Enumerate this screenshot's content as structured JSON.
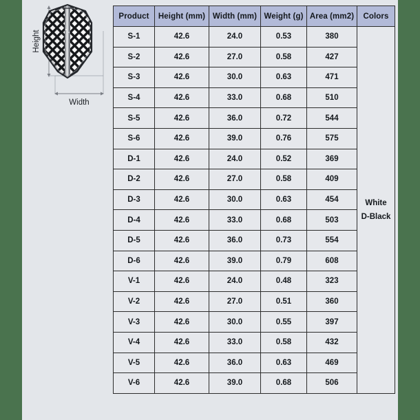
{
  "page": {
    "background_color": "#e3e6ea",
    "border_color": "#4a734e"
  },
  "diagram": {
    "name": "dart-flight-dimension-diagram",
    "height_label": "Height",
    "width_label": "Width",
    "shape": "standard-dart-flight",
    "pattern": "diamond-crosshatch-mesh"
  },
  "table": {
    "headers": [
      "Product",
      "Height (mm)",
      "Width (mm)",
      "Weight (g)",
      "Area (mm2)",
      "Colors"
    ],
    "colors_cell": [
      "White",
      "D-Black"
    ],
    "rows": [
      {
        "product": "S-1",
        "height": "42.6",
        "width": "24.0",
        "weight": "0.53",
        "area": "380"
      },
      {
        "product": "S-2",
        "height": "42.6",
        "width": "27.0",
        "weight": "0.58",
        "area": "427"
      },
      {
        "product": "S-3",
        "height": "42.6",
        "width": "30.0",
        "weight": "0.63",
        "area": "471"
      },
      {
        "product": "S-4",
        "height": "42.6",
        "width": "33.0",
        "weight": "0.68",
        "area": "510"
      },
      {
        "product": "S-5",
        "height": "42.6",
        "width": "36.0",
        "weight": "0.72",
        "area": "544"
      },
      {
        "product": "S-6",
        "height": "42.6",
        "width": "39.0",
        "weight": "0.76",
        "area": "575"
      },
      {
        "product": "D-1",
        "height": "42.6",
        "width": "24.0",
        "weight": "0.52",
        "area": "369"
      },
      {
        "product": "D-2",
        "height": "42.6",
        "width": "27.0",
        "weight": "0.58",
        "area": "409"
      },
      {
        "product": "D-3",
        "height": "42.6",
        "width": "30.0",
        "weight": "0.63",
        "area": "454"
      },
      {
        "product": "D-4",
        "height": "42.6",
        "width": "33.0",
        "weight": "0.68",
        "area": "503"
      },
      {
        "product": "D-5",
        "height": "42.6",
        "width": "36.0",
        "weight": "0.73",
        "area": "554"
      },
      {
        "product": "D-6",
        "height": "42.6",
        "width": "39.0",
        "weight": "0.79",
        "area": "608"
      },
      {
        "product": "V-1",
        "height": "42.6",
        "width": "24.0",
        "weight": "0.48",
        "area": "323"
      },
      {
        "product": "V-2",
        "height": "42.6",
        "width": "27.0",
        "weight": "0.51",
        "area": "360"
      },
      {
        "product": "V-3",
        "height": "42.6",
        "width": "30.0",
        "weight": "0.55",
        "area": "397"
      },
      {
        "product": "V-4",
        "height": "42.6",
        "width": "33.0",
        "weight": "0.58",
        "area": "432"
      },
      {
        "product": "V-5",
        "height": "42.6",
        "width": "36.0",
        "weight": "0.63",
        "area": "469"
      },
      {
        "product": "V-6",
        "height": "42.6",
        "width": "39.0",
        "weight": "0.68",
        "area": "506"
      }
    ]
  },
  "colors": {
    "header_fill": "#b2bad8",
    "cell_fill": "#e6e8ec",
    "border": "#2c2c2c",
    "page_green": "#4a734e"
  }
}
